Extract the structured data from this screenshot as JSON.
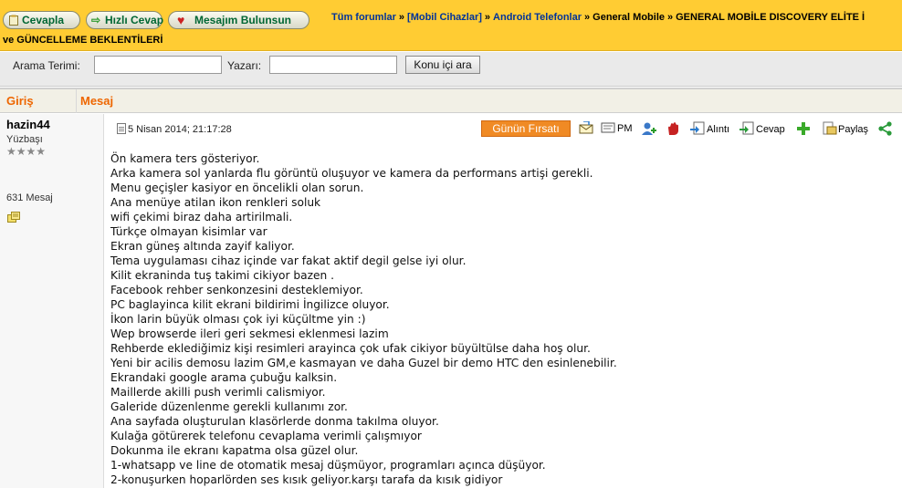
{
  "toolbar": {
    "reply_label": "Cevapla",
    "quick_reply_label": "Hızlı Cevap",
    "find_message_label": "Mesajım Bulunsun"
  },
  "breadcrumb": {
    "items": [
      "Tüm forumlar",
      "[Mobil Cihazlar]",
      "Android Telefonlar",
      "General Mobile"
    ],
    "current": "GENERAL MOBİLE DISCOVERY ELİTE İ",
    "title_cont": "ve GÜNCELLEME BEKLENTİLERİ"
  },
  "search": {
    "term_label": "Arama Terimi:",
    "user_label": "Yazarı:",
    "term_value": "",
    "user_value": "",
    "button_label": "Konu içi ara"
  },
  "table": {
    "col_author": "Giriş",
    "col_message": "Mesaj"
  },
  "author": {
    "username": "hazin44",
    "rank": "Yüzbaşı",
    "stars": "★★★★",
    "message_count": "631 Mesaj"
  },
  "post": {
    "date": "5 Nisan 2014; 21:17:28",
    "deal_label": "Günün Fırsatı",
    "pm_label": "PM",
    "quote_label": "Alıntı",
    "reply_label": "Cevap",
    "share_label": "Paylaş",
    "lines": [
      "Ön kamera ters gösteriyor.",
      "Arka kamera sol yanlarda flu görüntü oluşuyor ve kamera da performans artişi gerekli.",
      "Menu geçişler kasiyor en öncelikli olan sorun.",
      "Ana menüye atilan ikon renkleri soluk",
      "wifi çekimi biraz daha artirilmali.",
      "Türkçe olmayan kisimlar var",
      "Ekran güneş altında zayif kaliyor.",
      "Tema uygulaması cihaz içinde var fakat aktif degil gelse iyi olur.",
      "Kilit ekraninda tuş takimi cikiyor bazen .",
      "Facebook rehber senkonzesini desteklemiyor.",
      "PC baglayinca kilit ekrani bildirimi İngilizce oluyor.",
      "İkon larin büyük olması çok iyi küçültme yin :)",
      "Wep browserde ileri geri sekmesi eklenmesi lazim",
      "Rehberde eklediğimiz kişi resimleri arayinca çok ufak cikiyor büyültülse daha hoş olur.",
      "Yeni bir acilis demosu lazim GM,e kasmayan ve daha Guzel bir demo HTC den esinlenebilir.",
      "Ekrandaki google arama çubuğu kalksin.",
      "Maillerde akilli push verimli calismiyor.",
      "Galeride düzenlenme gerekli kullanımı zor.",
      "Ana sayfada oluşturulan klasörlerde donma takılma oluyor.",
      "Kulağa götürerek telefonu cevaplama verimli çalışmıyor",
      "Dokunma ile ekranı kapatma olsa güzel olur.",
      "1-whatsapp ve line de otomatik mesaj düşmüyor, programları açınca düşüyor.",
      "2-konuşurken hoparlörden ses kısık geliyor.karşı tarafa da kısık gidiyor"
    ]
  },
  "colors": {
    "topbar": "#ffcc33",
    "link": "#003399",
    "header_text": "#ee6600",
    "deal_button": "#f08a24",
    "button_text": "#006633"
  }
}
